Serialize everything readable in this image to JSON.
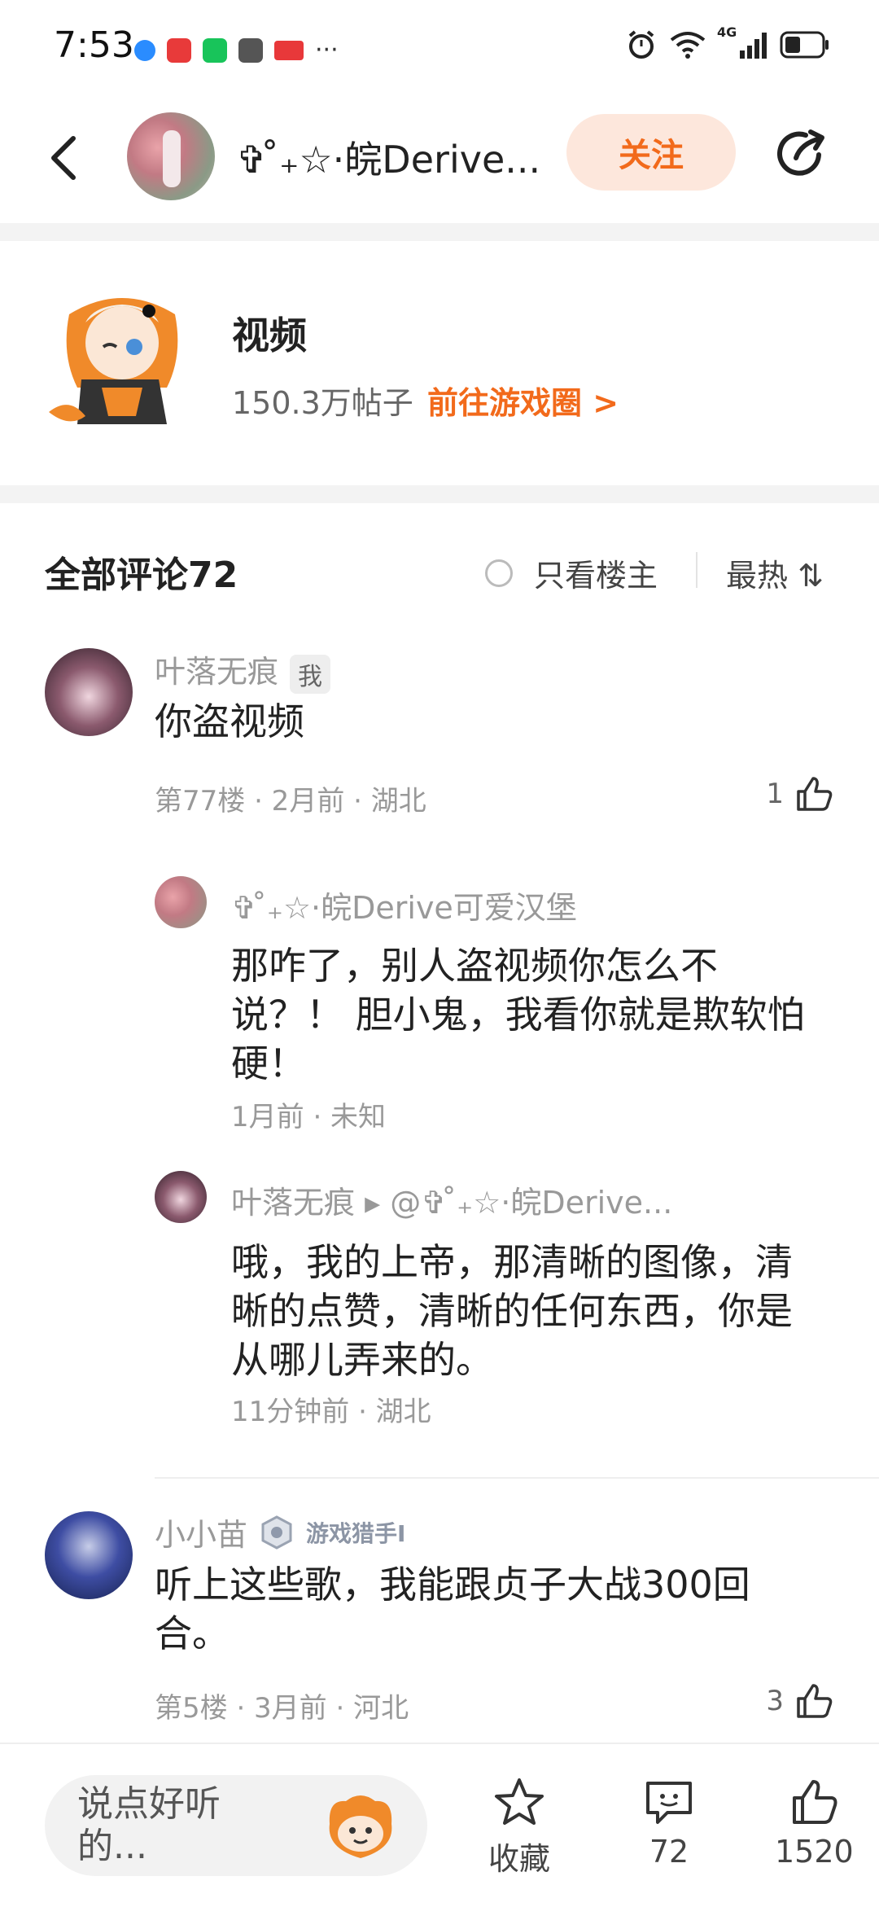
{
  "status_bar": {
    "time": "7:53",
    "more": "···",
    "network": "4G"
  },
  "header": {
    "title": "✞ ̊₊☆·皖Derive...",
    "follow_label": "关注"
  },
  "circle": {
    "name": "视频",
    "posts": "150.3万帖子",
    "link": "前往游戏圈 >"
  },
  "comments_header": {
    "title": "全部评论72",
    "only_owner": "只看楼主",
    "sort": "最热 ⇅"
  },
  "comments": [
    {
      "user": "叶落无痕",
      "badge": "我",
      "text": "你盗视频",
      "meta": "第77楼 · 2月前 · 湖北",
      "likes": "1",
      "replies": [
        {
          "user": "✞ ̊₊☆·皖Derive可爱汉堡",
          "text": "那咋了，别人盗视频你怎么不说？！ 胆小鬼，我看你就是欺软怕硬！",
          "meta": "1月前 · 未知"
        },
        {
          "user": "叶落无痕 ▸ @✞ ̊₊☆·皖Derive...",
          "text": "哦，我的上帝，那清晰的图像，清晰的点赞，清晰的任何东西，你是从哪儿弄来的。",
          "meta": "11分钟前 · 湖北"
        }
      ]
    },
    {
      "user": "小小苗",
      "badge": "游戏猎手I",
      "text": "听上这些歌，我能跟贞子大战300回合。",
      "meta": "第5楼 · 3月前 · 河北",
      "likes": "3"
    }
  ],
  "bottom_bar": {
    "input_placeholder": "说点好听的...",
    "favorite_label": "收藏",
    "comments_count": "72",
    "likes_count": "1520"
  },
  "colors": {
    "accent": "#f26a1b",
    "follow_bg": "#fde7dc",
    "divider": "#f3f3f3"
  }
}
